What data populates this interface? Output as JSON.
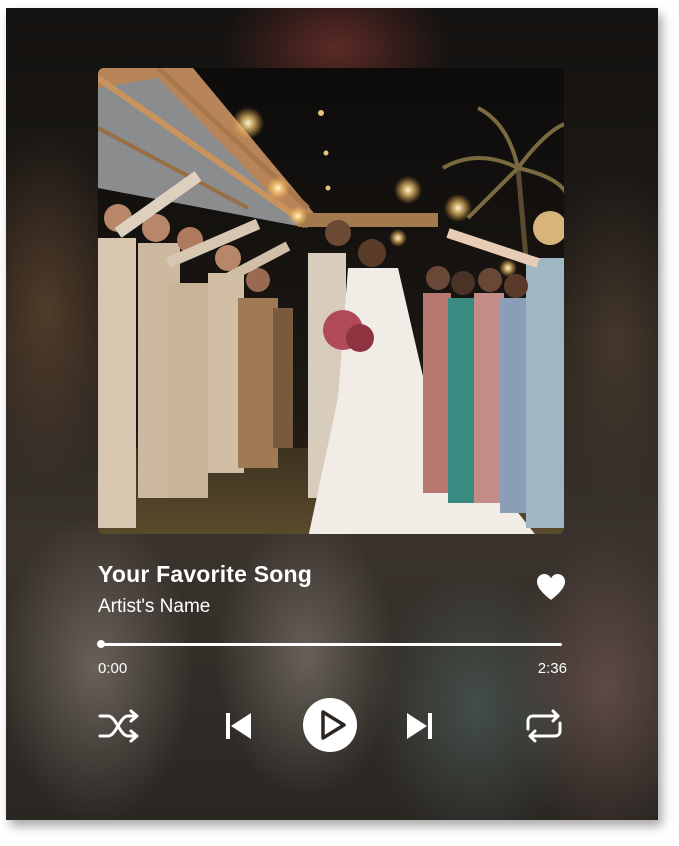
{
  "player": {
    "song_title": "Your Favorite Song",
    "artist_name": "Artist's Name",
    "time_current": "0:00",
    "time_total": "2:36",
    "progress_fraction": 0.0
  },
  "icons": {
    "like": "heart-icon",
    "shuffle": "shuffle-icon",
    "previous": "skip-previous-icon",
    "play": "play-icon",
    "next": "skip-next-icon",
    "repeat": "repeat-icon"
  },
  "colors": {
    "text": "#ffffff",
    "controls": "#ffffff",
    "play_glyph": "#2b2622"
  }
}
